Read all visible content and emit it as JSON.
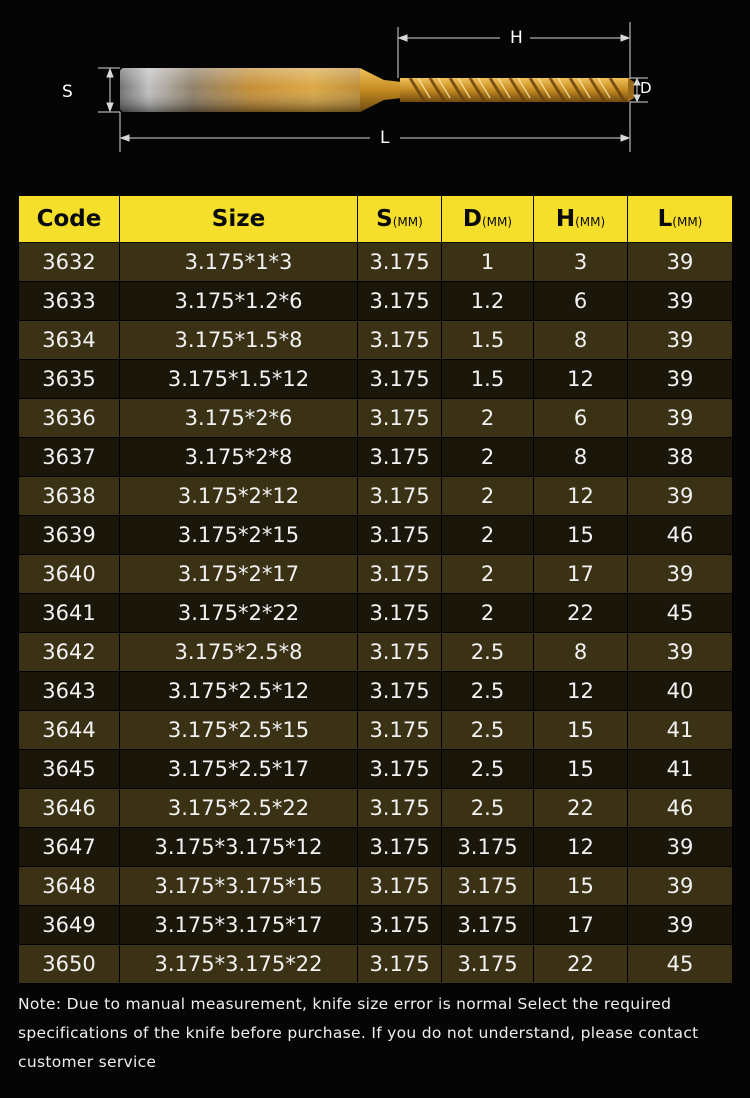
{
  "diagram": {
    "labels": {
      "s": "S",
      "h": "H",
      "l": "L",
      "d": "D"
    }
  },
  "table": {
    "headers": [
      {
        "main": "Code",
        "unit": ""
      },
      {
        "main": "Size",
        "unit": ""
      },
      {
        "main": "S",
        "unit": "(MM)"
      },
      {
        "main": "D",
        "unit": "(MM)"
      },
      {
        "main": "H",
        "unit": "(MM)"
      },
      {
        "main": "L",
        "unit": "(MM)"
      }
    ],
    "rows": [
      [
        "3632",
        "3.175*1*3",
        "3.175",
        "1",
        "3",
        "39"
      ],
      [
        "3633",
        "3.175*1.2*6",
        "3.175",
        "1.2",
        "6",
        "39"
      ],
      [
        "3634",
        "3.175*1.5*8",
        "3.175",
        "1.5",
        "8",
        "39"
      ],
      [
        "3635",
        "3.175*1.5*12",
        "3.175",
        "1.5",
        "12",
        "39"
      ],
      [
        "3636",
        "3.175*2*6",
        "3.175",
        "2",
        "6",
        "39"
      ],
      [
        "3637",
        "3.175*2*8",
        "3.175",
        "2",
        "8",
        "38"
      ],
      [
        "3638",
        "3.175*2*12",
        "3.175",
        "2",
        "12",
        "39"
      ],
      [
        "3639",
        "3.175*2*15",
        "3.175",
        "2",
        "15",
        "46"
      ],
      [
        "3640",
        "3.175*2*17",
        "3.175",
        "2",
        "17",
        "39"
      ],
      [
        "3641",
        "3.175*2*22",
        "3.175",
        "2",
        "22",
        "45"
      ],
      [
        "3642",
        "3.175*2.5*8",
        "3.175",
        "2.5",
        "8",
        "39"
      ],
      [
        "3643",
        "3.175*2.5*12",
        "3.175",
        "2.5",
        "12",
        "40"
      ],
      [
        "3644",
        "3.175*2.5*15",
        "3.175",
        "2.5",
        "15",
        "41"
      ],
      [
        "3645",
        "3.175*2.5*17",
        "3.175",
        "2.5",
        "15",
        "41"
      ],
      [
        "3646",
        "3.175*2.5*22",
        "3.175",
        "2.5",
        "22",
        "46"
      ],
      [
        "3647",
        "3.175*3.175*12",
        "3.175",
        "3.175",
        "12",
        "39"
      ],
      [
        "3648",
        "3.175*3.175*15",
        "3.175",
        "3.175",
        "15",
        "39"
      ],
      [
        "3649",
        "3.175*3.175*17",
        "3.175",
        "3.175",
        "17",
        "39"
      ],
      [
        "3650",
        "3.175*3.175*22",
        "3.175",
        "3.175",
        "22",
        "45"
      ]
    ]
  },
  "note": "Note: Due to manual measurement, knife size error is normal Select the required specifications of the knife before purchase. If you do not understand, please contact customer service",
  "colors": {
    "header_bg": "#f6df2a",
    "row_odd": "#3b3216",
    "row_even": "#1b160a",
    "page_bg": "#050505"
  }
}
